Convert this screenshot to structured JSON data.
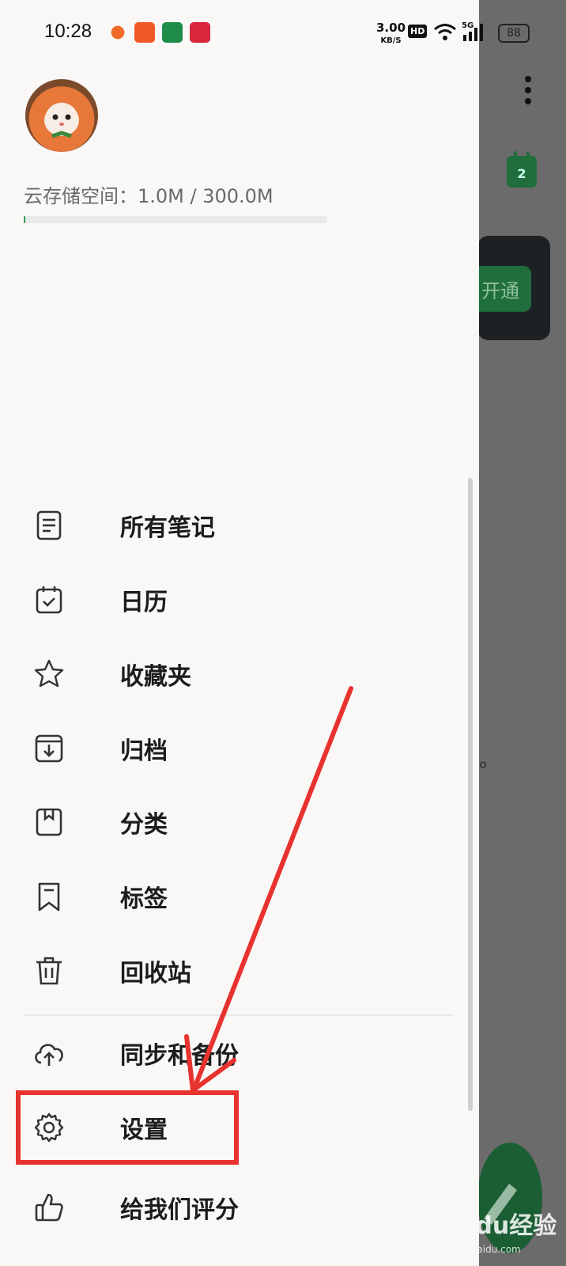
{
  "status_bar": {
    "time": "10:28",
    "net_speed": "3.00",
    "net_unit": "KB/S",
    "hd": "HD",
    "network": "5G",
    "battery": "88"
  },
  "drawer": {
    "storage_text": "云存储空间：1.0M / 300.0M",
    "storage_used_fraction": 0.0033,
    "menu": [
      {
        "label": "所有笔记",
        "icon": "note-icon"
      },
      {
        "label": "日历",
        "icon": "calendar-icon"
      },
      {
        "label": "收藏夹",
        "icon": "star-icon"
      },
      {
        "label": "归档",
        "icon": "archive-icon"
      },
      {
        "label": "分类",
        "icon": "category-icon"
      },
      {
        "label": "标签",
        "icon": "bookmark-icon"
      },
      {
        "label": "回收站",
        "icon": "trash-icon"
      }
    ],
    "menu2": [
      {
        "label": "同步和备份",
        "icon": "cloud-upload-icon"
      },
      {
        "label": "设置",
        "icon": "gear-icon"
      },
      {
        "label": "给我们评分",
        "icon": "thumbs-up-icon"
      }
    ]
  },
  "background": {
    "calendar_day": "2",
    "open_button": "开通",
    "partial_text": "。",
    "watermark": "Baidu经验",
    "watermark_url": "jingyan.baidu.com"
  },
  "colors": {
    "accent": "#1f6e3c",
    "annotation": "#e8322e"
  }
}
